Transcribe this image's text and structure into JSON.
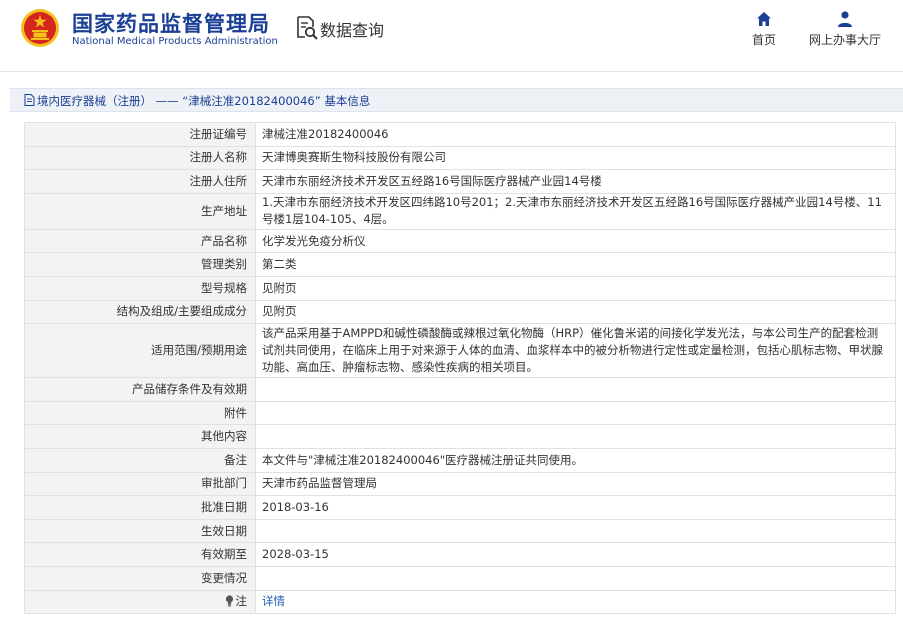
{
  "header": {
    "org_name_cn": "国家药品监督管理局",
    "org_name_en": "National Medical Products Administration",
    "data_query_label": "数据查询",
    "nav": [
      {
        "label": "首页",
        "icon": "home-icon"
      },
      {
        "label": "网上办事大厅",
        "icon": "user-icon"
      }
    ],
    "colors": {
      "brand": "#1a3f95",
      "emblem_red": "#d7261e",
      "emblem_gold": "#f2c21a"
    }
  },
  "breadcrumb": {
    "text": "境内医疗器械（注册） —— “津械注准20182400046” 基本信息",
    "icon": "document-icon"
  },
  "details": [
    {
      "label": "注册证编号",
      "value": "津械注准20182400046"
    },
    {
      "label": "注册人名称",
      "value": "天津博奥赛斯生物科技股份有限公司"
    },
    {
      "label": "注册人住所",
      "value": "天津市东丽经济技术开发区五经路16号国际医疗器械产业园14号楼"
    },
    {
      "label": "生产地址",
      "value": "1.天津市东丽经济技术开发区四纬路10号201；2.天津市东丽经济技术开发区五经路16号国际医疗器械产业园14号楼、11号楼1层104-105、4层。"
    },
    {
      "label": "产品名称",
      "value": "化学发光免疫分析仪"
    },
    {
      "label": "管理类别",
      "value": "第二类"
    },
    {
      "label": "型号规格",
      "value": "见附页"
    },
    {
      "label": "结构及组成/主要组成成分",
      "value": "见附页"
    },
    {
      "label": "适用范围/预期用途",
      "value": "该产品采用基于AMPPD和碱性磷酸酶或辣根过氧化物酶（HRP）催化鲁米诺的间接化学发光法，与本公司生产的配套检测试剂共同使用，在临床上用于对来源于人体的血清、血浆样本中的被分析物进行定性或定量检测，包括心肌标志物、甲状腺功能、高血压、肿瘤标志物、感染性疾病的相关项目。"
    },
    {
      "label": "产品储存条件及有效期",
      "value": ""
    },
    {
      "label": "附件",
      "value": ""
    },
    {
      "label": "其他内容",
      "value": ""
    },
    {
      "label": "备注",
      "value": "本文件与\"津械注准20182400046\"医疗器械注册证共同使用。"
    },
    {
      "label": "审批部门",
      "value": "天津市药品监督管理局"
    },
    {
      "label": "批准日期",
      "value": "2018-03-16"
    },
    {
      "label": "生效日期",
      "value": ""
    },
    {
      "label": "有效期至",
      "value": "2028-03-15"
    },
    {
      "label": "变更情况",
      "value": ""
    }
  ],
  "footnote": {
    "label": "注",
    "icon": "lightbulb-icon",
    "link_label": "详情"
  }
}
